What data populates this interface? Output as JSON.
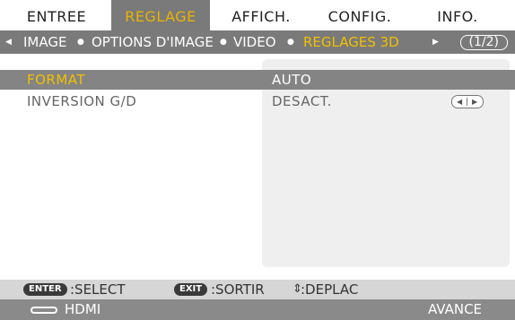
{
  "tabs": [
    {
      "label": "ENTREE",
      "active": false
    },
    {
      "label": "REGLAGE",
      "active": true
    },
    {
      "label": "AFFICH.",
      "active": false
    },
    {
      "label": "CONFIG.",
      "active": false
    },
    {
      "label": "INFO.",
      "active": false
    }
  ],
  "subnav": {
    "items": [
      "IMAGE",
      "OPTIONS D'IMAGE",
      "VIDEO",
      "REGLAGES 3D"
    ],
    "active": "REGLAGES 3D",
    "page": "1/2"
  },
  "settings": [
    {
      "label": "FORMAT",
      "value": "AUTO",
      "selected": true
    },
    {
      "label": "INVERSION G/D",
      "value": "DESACT.",
      "selected": false
    }
  ],
  "help": {
    "enter_key": "ENTER",
    "enter_action": ":SELECT",
    "exit_key": "EXIT",
    "exit_action": ":SORTIR",
    "move_glyph": "⇕",
    "move_action": ":DEPLAC"
  },
  "footer": {
    "source": "HDMI",
    "mode": "AVANCE"
  },
  "colors": {
    "accent": "#f1c000",
    "bar_gray": "#7a7a7a",
    "selected_row": "#848484"
  }
}
